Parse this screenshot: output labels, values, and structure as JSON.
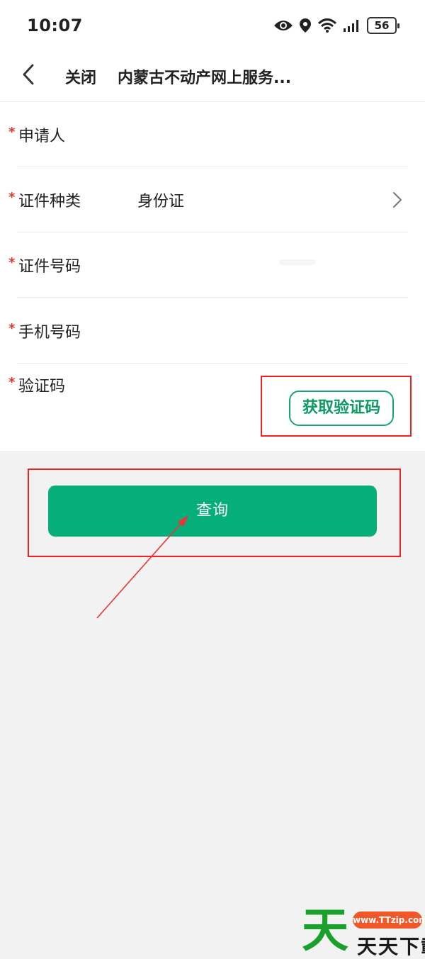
{
  "status_bar": {
    "time": "10:07",
    "battery": "56",
    "icons": [
      "eye-icon",
      "location-icon",
      "wifi-icon",
      "signal-icon",
      "battery-icon"
    ]
  },
  "nav": {
    "close_label": "关闭",
    "title": "内蒙古不动产网上服务..."
  },
  "form": {
    "required_mark": "*",
    "rows": [
      {
        "label": "申请人",
        "value": ""
      },
      {
        "label": "证件种类",
        "value": "身份证"
      },
      {
        "label": "证件号码",
        "value": ""
      },
      {
        "label": "手机号码",
        "value": ""
      },
      {
        "label": "验证码",
        "value": ""
      }
    ],
    "get_code_label": "获取验证码"
  },
  "query_button_label": "查询",
  "watermark": {
    "char": "天",
    "url": "www.TTzip.com",
    "text": "天天下載"
  },
  "colors": {
    "accent_green": "#06ae7a",
    "required_red": "#e0372f",
    "annotation_red": "#e22222"
  }
}
